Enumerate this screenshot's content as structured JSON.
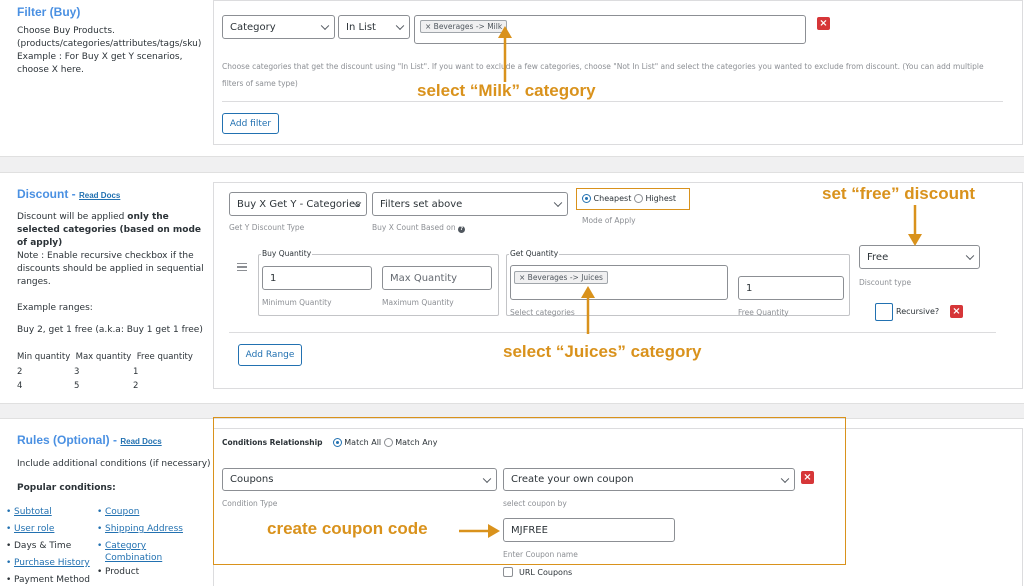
{
  "filter": {
    "title": "Filter (Buy)",
    "desc1": "Choose Buy Products.",
    "desc2": "(products/categories/attributes/tags/sku)",
    "desc3": "Example : For Buy X get Y scenarios, choose X here.",
    "type_select": "Category",
    "op_select": "In List",
    "chip": "× Beverages -> Milk",
    "help": "Choose categories that get the discount using \"In List\". If you want to exclude a few categories, choose \"Not In List\" and select the categories you wanted to exclude from discount. (You can add multiple filters of same type)",
    "add_filter": "Add filter",
    "annotation": "select “Milk” category"
  },
  "discount": {
    "title": "Discount - ",
    "read_docs": "Read Docs",
    "desc_pre": "Discount will be applied ",
    "desc_bold": "only the selected categories (based on mode of apply)",
    "note": "Note : Enable recursive checkbox if the discounts should be applied in sequential ranges.",
    "example": "Example ranges:",
    "buy2": "Buy 2, get 1 free (a.k.a: Buy 1 get 1 free)",
    "table_header": "Min quantity  Max quantity  Free quantity",
    "rows": [
      [
        "2",
        "3",
        "1"
      ],
      [
        "4",
        "5",
        "2"
      ]
    ],
    "type_select": "Buy X Get Y - Categories",
    "type_sub": "Get Y Discount Type",
    "count_select": "Filters set above",
    "count_sub": "Buy X Count Based on",
    "mode_cheapest": "Cheapest",
    "mode_highest": "Highest",
    "mode_sub": "Mode of Apply",
    "buy_qty_legend": "Buy Quantity",
    "min_qty": "1",
    "min_sub": "Minimum Quantity",
    "max_ph": "Max Quantity",
    "max_sub": "Maximum Quantity",
    "get_qty_legend": "Get Quantity",
    "get_chip": "× Beverages -> Juices",
    "get_sub": "Select categories",
    "free_qty": "1",
    "free_sub": "Free Quantity",
    "disc_type": "Free",
    "disc_type_sub": "Discount type",
    "recursive": "Recursive?",
    "add_range": "Add Range",
    "annot_free": "set “free” discount",
    "annot_juices": "select “Juices” category"
  },
  "rules": {
    "title": "Rules (Optional) - ",
    "read_docs": "Read Docs",
    "desc": "Include additional conditions (if necessary)",
    "popular": "Popular conditions:",
    "col1": [
      "Subtotal",
      "User role",
      "Days & Time",
      "Purchase History",
      "Payment Method"
    ],
    "col2": [
      "Coupon",
      "Shipping Address",
      "Category Combination",
      "Product"
    ],
    "relationship": "Conditions Relationship",
    "match_all": "Match All",
    "match_any": "Match Any",
    "cond_select": "Coupons",
    "cond_sub": "Condition Type",
    "coupon_select": "Create your own coupon",
    "coupon_sub": "select coupon by",
    "coupon_code": "MJFREE",
    "coupon_name_sub": "Enter Coupon name",
    "url_coupons": "URL Coupons",
    "annot_coupon": "create coupon code"
  }
}
